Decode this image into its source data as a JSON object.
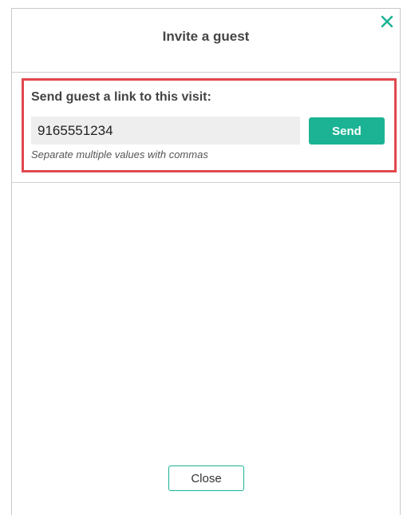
{
  "dialog": {
    "title": "Invite a guest",
    "close_icon": "close-icon"
  },
  "invite": {
    "label": "Send guest a link to this visit:",
    "input_value": "9165551234",
    "send_label": "Send",
    "hint": "Separate multiple values with commas"
  },
  "footer": {
    "close_label": "Close"
  },
  "colors": {
    "accent": "#1bb394",
    "highlight": "#e0474c"
  }
}
